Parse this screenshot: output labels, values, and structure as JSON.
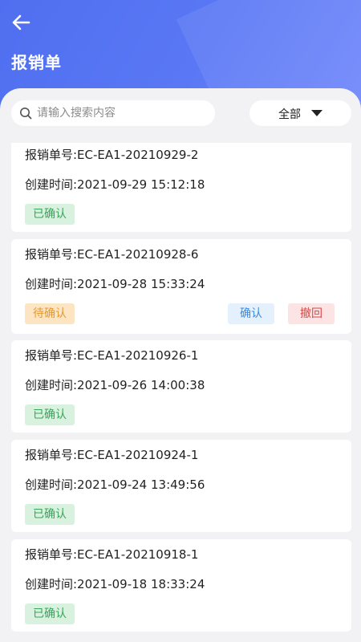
{
  "header": {
    "title": "报销单",
    "back_icon": "arrow-left-icon"
  },
  "search": {
    "placeholder": "请输入搜索内容",
    "value": ""
  },
  "filter": {
    "selected": "全部"
  },
  "colors": {
    "header_accent": "#5a78f5",
    "confirmed_bg": "#d9f2df",
    "confirmed_text": "#3aa35a",
    "pending_bg": "#fde5c3",
    "pending_text": "#e39a30",
    "confirm_btn_text": "#3a8ae0",
    "revoke_btn_text": "#d94848"
  },
  "orders": [
    {
      "number_text": "报销单号:EC-EA1-20210929-2",
      "time_text": "创建时间:2021-09-29 15:12:18",
      "status": "已确认"
    },
    {
      "number_text": "报销单号:EC-EA1-20210928-6",
      "time_text": "创建时间:2021-09-28 15:33:24",
      "status": "待确认",
      "confirm_label": "确认",
      "revoke_label": "撤回"
    },
    {
      "number_text": "报销单号:EC-EA1-20210926-1",
      "time_text": "创建时间:2021-09-26 14:00:38",
      "status": "已确认"
    },
    {
      "number_text": "报销单号:EC-EA1-20210924-1",
      "time_text": "创建时间:2021-09-24 13:49:56",
      "status": "已确认"
    },
    {
      "number_text": "报销单号:EC-EA1-20210918-1",
      "time_text": "创建时间:2021-09-18 18:33:24",
      "status": "已确认"
    }
  ]
}
